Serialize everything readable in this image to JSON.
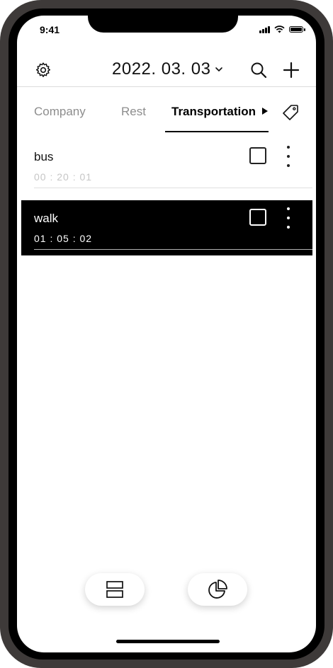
{
  "status_bar": {
    "time": "9:41"
  },
  "header": {
    "date": "2022. 03. 03",
    "icons": [
      "gear-icon",
      "chevron-down-icon",
      "search-icon",
      "plus-icon"
    ]
  },
  "tabs": [
    {
      "label": "Company",
      "active": false
    },
    {
      "label": "Rest",
      "active": false
    },
    {
      "label": "Transportation",
      "active": true
    }
  ],
  "tag_icon": "tag-icon",
  "entries": [
    {
      "label": "bus",
      "time": "00 : 20 : 01",
      "selected": false
    },
    {
      "label": "walk",
      "time": "01 : 05 : 02",
      "selected": true
    }
  ],
  "bottom_nav": {
    "icons": [
      "list-view-icon",
      "pie-chart-icon"
    ]
  },
  "colors": {
    "frame": "#3e3a39",
    "selected_row": "#000000",
    "muted_text": "#8d8d8d"
  }
}
